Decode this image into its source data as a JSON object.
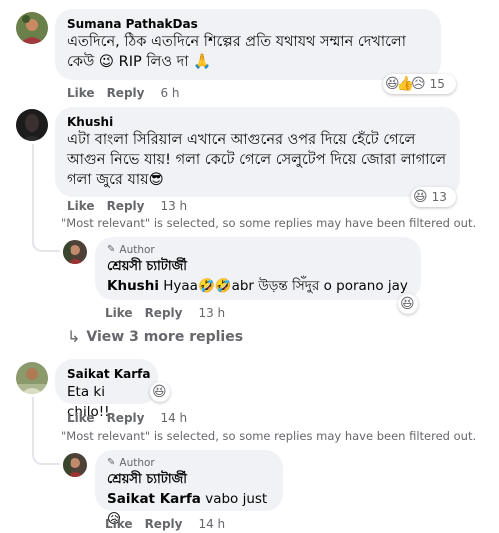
{
  "actions": {
    "like": "Like",
    "reply": "Reply"
  },
  "author_badge": "Author",
  "filter_note": "\"Most relevant\" is selected, so some replies may have been filtered out.",
  "comments": [
    {
      "name": "Sumana PathakDas",
      "text": "এতদিনে, ঠিক এতদিনে শিল্পের প্রতি যথাযথ সম্মান দেখালো কেউ 😉 RIP লিও দা 🙏",
      "time": "6 h",
      "reactions": {
        "icons": [
          "laugh-icon",
          "like-icon",
          "sad-icon"
        ],
        "glyphs": [
          "😆",
          "👍",
          "😥"
        ],
        "count": "15"
      }
    },
    {
      "name": "Khushi",
      "text": "এটা বাংলা সিরিয়াল এখানে আগুনের ওপর দিয়ে হেঁটে গেলে আগুন নিভে যায়! গলা কেটে গেলে সেলুটেপ দিয়ে জোরা লাগালে গলা জুরে যায়😎",
      "time": "13 h",
      "reactions": {
        "icons": [
          "laugh-icon"
        ],
        "glyphs": [
          "😆"
        ],
        "count": "13"
      }
    },
    {
      "name": "Saikat Karfa",
      "text": "Eta ki chilo!!",
      "time": "14 h",
      "reactions": {
        "icons": [
          "laugh-icon"
        ],
        "glyphs": [
          "😆"
        ],
        "count": ""
      }
    }
  ],
  "replies": [
    {
      "name": "শ্রেয়সী চ্যাটার্জী",
      "mention": "Khushi",
      "text": " Hyaa🤣🤣abr উড়ন্ত সিঁদুর o porano jay",
      "time": "13 h",
      "reaction_glyph": "😆"
    },
    {
      "name": "শ্রেয়সী চ্যাটার্জী",
      "mention": "Saikat Karfa",
      "text": " vabo just 😥",
      "time": "14 h"
    }
  ],
  "view_more": "View 3 more replies",
  "colors": {
    "bubble": "#f0f2f5",
    "secondary_text": "#65676b",
    "thread_line": "#e4e6eb"
  }
}
